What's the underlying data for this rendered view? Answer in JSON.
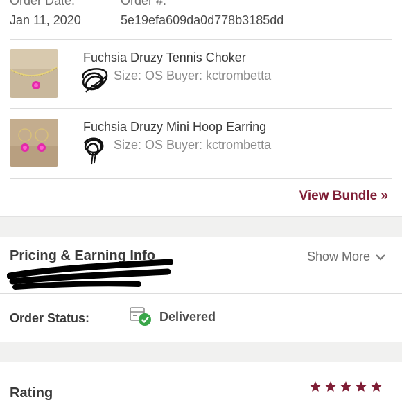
{
  "order": {
    "date_label": "Order Date:",
    "date_value": "Jan 11, 2020",
    "number_label": "Order #:",
    "number_value": "5e19efa609da0d778b3185dd"
  },
  "items": [
    {
      "title": "Fuchsia Druzy Tennis Choker",
      "subtitle": "Size: OS  Buyer: kctrombetta"
    },
    {
      "title": "Fuchsia Druzy Mini Hoop Earring",
      "subtitle": "Size: OS  Buyer: kctrombetta"
    }
  ],
  "bundle": {
    "link_label": "View Bundle »"
  },
  "pricing": {
    "title": "Pricing & Earning Info",
    "show_more_label": "Show More"
  },
  "status": {
    "label": "Order Status:",
    "value": "Delivered",
    "icon": "package-delivered-icon",
    "check_color": "#3aa64a"
  },
  "rating": {
    "title": "Rating",
    "stars": 5,
    "star_color": "#7f1d35"
  },
  "colors": {
    "accent": "#7f1d35",
    "divider": "#dcdcdc",
    "band": "#f1f1f0"
  }
}
